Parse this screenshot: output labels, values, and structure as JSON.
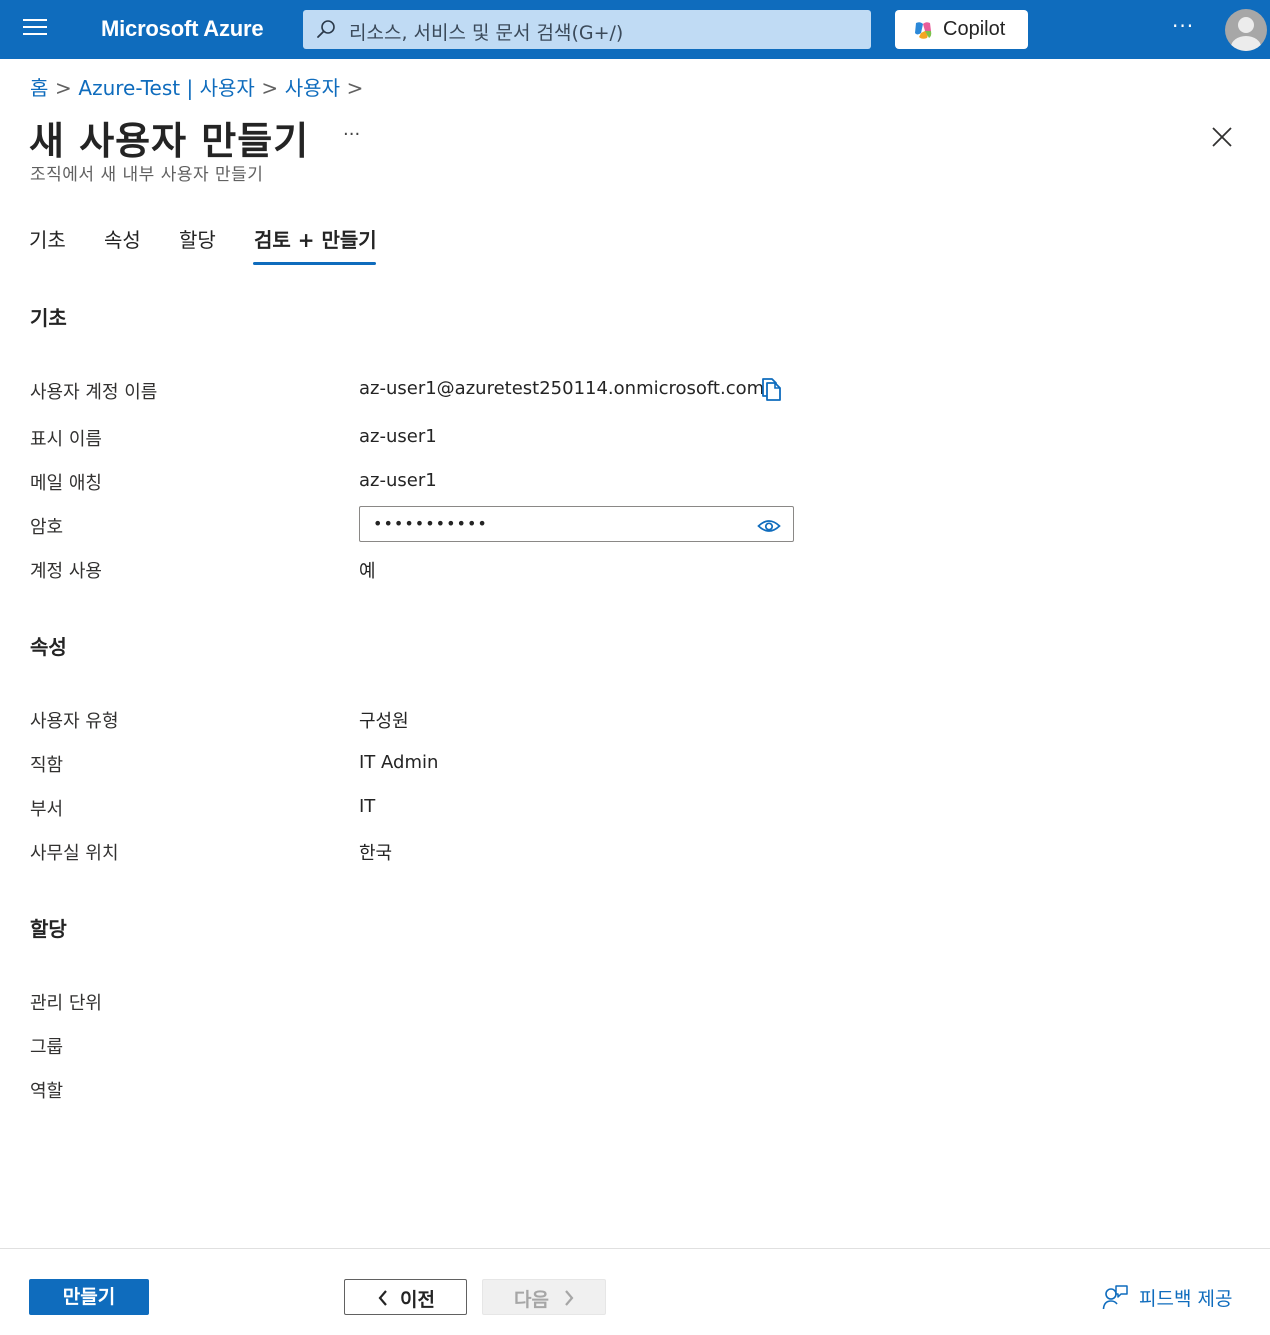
{
  "topbar": {
    "brand": "Microsoft Azure",
    "search_placeholder": "리소스, 서비스 및 문서 검색(G+/)",
    "copilot_label": "Copilot",
    "more_label": "···",
    "accent_color": "#0f6cbd"
  },
  "breadcrumb": {
    "items": [
      "홈",
      "Azure-Test | 사용자",
      "사용자"
    ],
    "separator": ">"
  },
  "header": {
    "title": "새 사용자 만들기",
    "more_label": "···",
    "subtitle": "조직에서 새 내부 사용자 만들기"
  },
  "tabs": [
    {
      "label": "기초",
      "active": false
    },
    {
      "label": "속성",
      "active": false
    },
    {
      "label": "할당",
      "active": false
    },
    {
      "label": "검토 + 만들기",
      "active": true
    }
  ],
  "basics": {
    "title": "기초",
    "upn_label": "사용자 계정 이름",
    "upn_value": "az-user1@azuretest250114.onmicrosoft.com",
    "display_label": "표시 이름",
    "display_value": "az-user1",
    "mailnick_label": "메일 애칭",
    "mailnick_value": "az-user1",
    "password_label": "암호",
    "password_value": "•••••••••••",
    "enabled_label": "계정 사용",
    "enabled_value": "예"
  },
  "properties": {
    "title": "속성",
    "usertype_label": "사용자 유형",
    "usertype_value": "구성원",
    "jobtitle_label": "직함",
    "jobtitle_value": "IT Admin",
    "dept_label": "부서",
    "dept_value": "IT",
    "office_label": "사무실 위치",
    "office_value": "한국"
  },
  "assignments": {
    "title": "할당",
    "admin_units_label": "관리 단위",
    "groups_label": "그룹",
    "roles_label": "역할"
  },
  "footer": {
    "create_label": "만들기",
    "prev_label": "이전",
    "next_label": "다음",
    "feedback_label": "피드백 제공"
  }
}
